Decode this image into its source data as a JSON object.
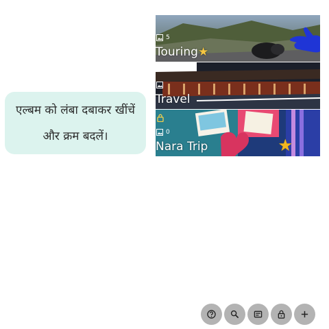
{
  "tooltip": {
    "text": "एल्बम को लंबा दबाकर खींचें और क्रम बदलें।"
  },
  "albums": [
    {
      "title": "Touring",
      "count": "5",
      "starred": true,
      "locked": false
    },
    {
      "title": "Travel",
      "count": "",
      "starred": false,
      "locked": false
    },
    {
      "title": "Nara Trip",
      "count": "0",
      "starred": false,
      "locked": true
    }
  ],
  "toolbar": {
    "buttons": [
      {
        "icon": "help-icon"
      },
      {
        "icon": "search-icon"
      },
      {
        "icon": "card-icon"
      },
      {
        "icon": "lock-icon"
      },
      {
        "icon": "plus-icon"
      }
    ]
  },
  "colors": {
    "tooltip_bg": "#dcf3ee",
    "toolbar_button": "#b3b3b3",
    "hand": "#1f35d6",
    "star": "#f5c542"
  }
}
